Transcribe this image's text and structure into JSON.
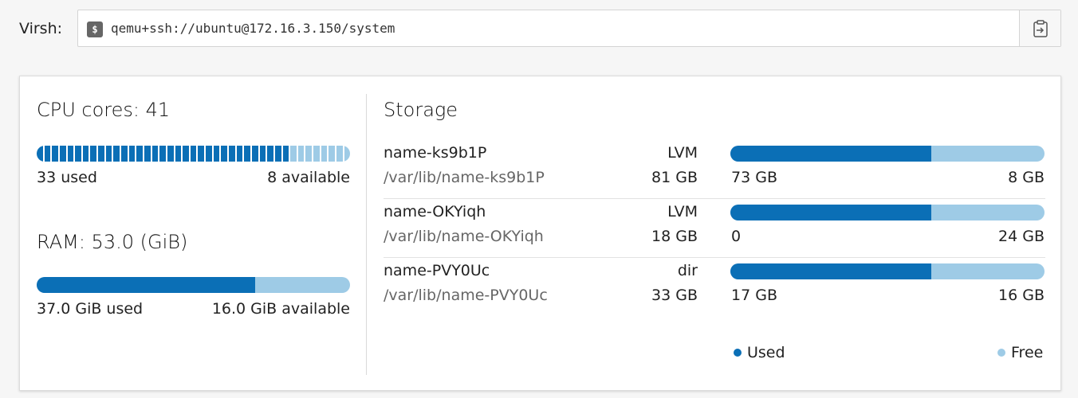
{
  "virsh": {
    "label": "Virsh:",
    "command": "qemu+ssh://ubuntu@172.16.3.150/system",
    "terminal_icon_glyph": "$"
  },
  "cpu": {
    "title": "CPU cores: 41",
    "total": 41,
    "used": 33,
    "used_label": "33 used",
    "available_label": "8 available"
  },
  "ram": {
    "title": "RAM: 53.0 (GiB)",
    "used_fraction": 0.698,
    "used_label": "37.0 GiB used",
    "available_label": "16.0 GiB available"
  },
  "storage": {
    "title": "Storage",
    "pools": [
      {
        "name": "name-ks9b1P",
        "type": "LVM",
        "path": "/var/lib/name-ks9b1P",
        "size": "81 GB",
        "used": "73 GB",
        "free": "8 GB",
        "used_fraction": 0.64
      },
      {
        "name": "name-OKYiqh",
        "type": "LVM",
        "path": "/var/lib/name-OKYiqh",
        "size": "18 GB",
        "used": "0",
        "free": "24 GB",
        "used_fraction": 0.64
      },
      {
        "name": "name-PVY0Uc",
        "type": "dir",
        "path": "/var/lib/name-PVY0Uc",
        "size": "33 GB",
        "used": "17 GB",
        "free": "16 GB",
        "used_fraction": 0.64
      }
    ],
    "legend": {
      "used": "Used",
      "free": "Free"
    }
  },
  "colors": {
    "used": "#0b6fb6",
    "free": "#9ecbe6"
  },
  "icons": {
    "copy": "clipboard-icon",
    "terminal": "terminal-icon"
  }
}
